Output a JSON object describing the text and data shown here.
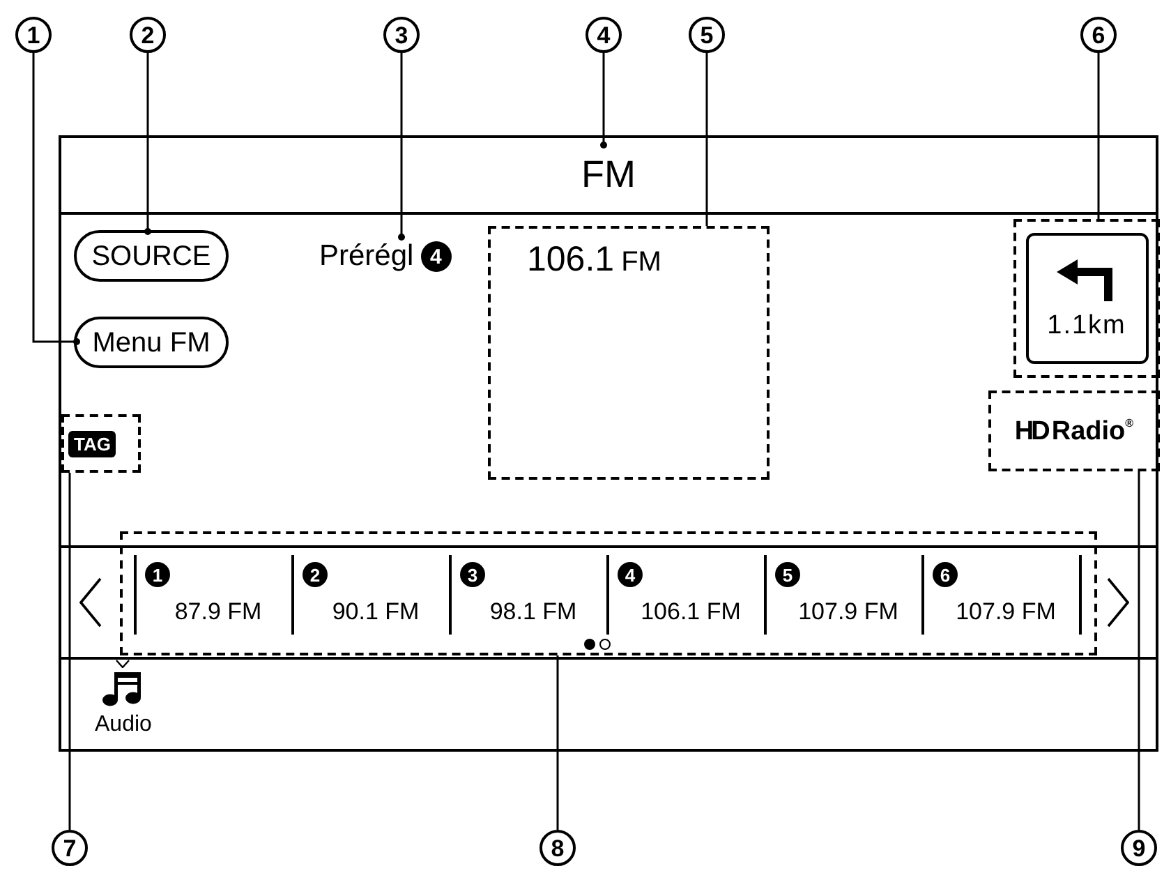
{
  "callouts": [
    {
      "number": "1"
    },
    {
      "number": "2"
    },
    {
      "number": "3"
    },
    {
      "number": "4"
    },
    {
      "number": "5"
    },
    {
      "number": "6"
    },
    {
      "number": "7"
    },
    {
      "number": "8"
    },
    {
      "number": "9"
    }
  ],
  "screen": {
    "title": "FM",
    "buttons": [
      {
        "label": "SOURCE"
      },
      {
        "label": "Menu FM"
      }
    ],
    "tag_badge": "TAG",
    "preset_label": {
      "text": "Prérégl",
      "number": "4"
    },
    "station_display": {
      "frequency": "106.1",
      "band": "FM"
    },
    "turn_guidance": {
      "distance": "1.1km"
    },
    "hd_radio_logo": {
      "mark": "HD",
      "name": "Radio",
      "symbol": "®"
    },
    "presets": [
      {
        "number": "1",
        "frequency": "87.9 FM"
      },
      {
        "number": "2",
        "frequency": "90.1 FM"
      },
      {
        "number": "3",
        "frequency": "98.1 FM"
      },
      {
        "number": "4",
        "frequency": "106.1 FM"
      },
      {
        "number": "5",
        "frequency": "107.9 FM"
      },
      {
        "number": "6",
        "frequency": "107.9 FM"
      }
    ],
    "pages": [
      {
        "selected": true
      },
      {
        "selected": false
      }
    ],
    "bottom_nav": [
      {
        "label": "Audio",
        "selected": true
      }
    ]
  }
}
